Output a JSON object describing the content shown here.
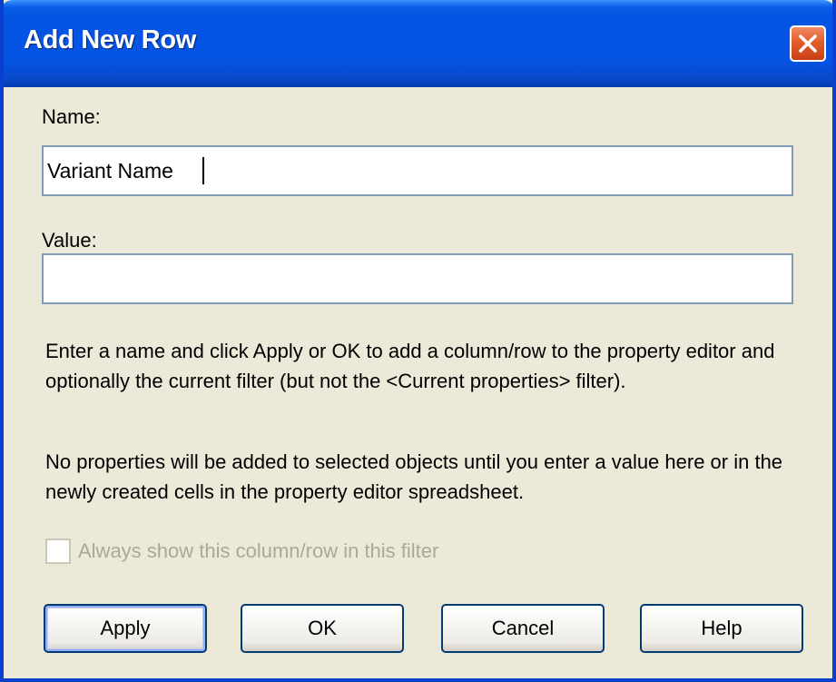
{
  "dialog": {
    "title": "Add New Row"
  },
  "form": {
    "name_label": "Name:",
    "name_value": "Variant Name",
    "value_label": "Value:",
    "value_value": ""
  },
  "help_text": {
    "paragraph1": "Enter a name and click Apply or OK to add a column/row to the property editor and optionally the current filter (but not the <Current properties> filter).",
    "paragraph2": "No properties will be added to selected objects until you enter a value here or in the newly created cells in the property editor spreadsheet."
  },
  "checkbox": {
    "label": "Always show this column/row in this filter",
    "checked": false,
    "enabled": false
  },
  "buttons": {
    "apply": "Apply",
    "ok": "OK",
    "cancel": "Cancel",
    "help": "Help"
  },
  "colors": {
    "titlebar": "#0554e3",
    "dialog_bg": "#ece9d8",
    "close_button": "#e35d2a",
    "textbox_border": "#7f9db9",
    "disabled_text": "#aca899"
  },
  "icons": {
    "close": "close-x-icon"
  }
}
